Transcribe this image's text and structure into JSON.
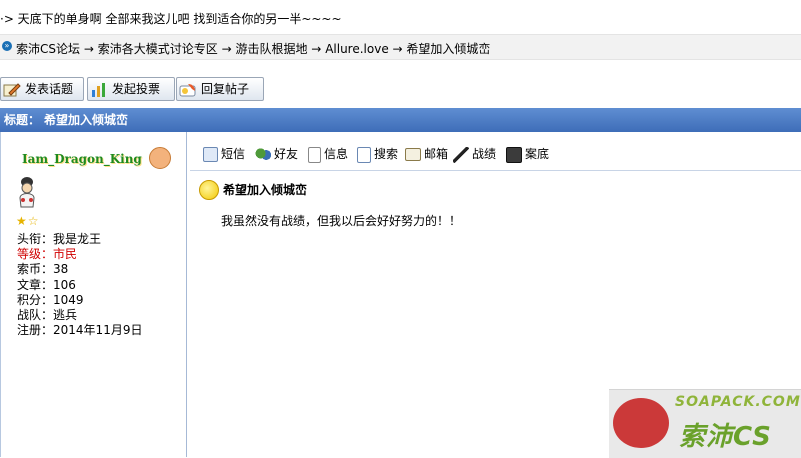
{
  "marquee": {
    "text": "·> 天底下的单身啊 全部来我这儿吧 找到适合你的另一半~~~~"
  },
  "breadcrumb": {
    "items": [
      "索沛CS论坛",
      "索沛各大模式讨论专区",
      "游击队根据地",
      "Allure.love",
      "希望加入倾城峦"
    ],
    "separator": "→"
  },
  "toolbar": {
    "new_topic": "发表话题",
    "new_poll": "发起投票",
    "reply": "回复帖子"
  },
  "topic": {
    "label": "标题：",
    "title": "希望加入倾城峦"
  },
  "user": {
    "name": "Iam_Dragon_King",
    "stars": "★☆",
    "title_label": "头衔：",
    "title_value": "我是龙王",
    "level_label": "等级：",
    "level_value": "市民",
    "coins_label": "索币：",
    "coins_value": "38",
    "posts_label": "文章：",
    "posts_value": "106",
    "points_label": "积分：",
    "points_value": "1049",
    "team_label": "战队：",
    "team_value": "逃兵",
    "reg_label": "注册：",
    "reg_value": "2014年11月9日"
  },
  "actions": {
    "sms": "短信",
    "friend": "好友",
    "info": "信息",
    "search": "搜索",
    "email": "邮箱",
    "record": "战绩",
    "case": "案底"
  },
  "post": {
    "title": "希望加入倾城峦",
    "body": "我虽然没有战绩，但我以后会好好努力的！！"
  },
  "watermark": {
    "top": "SOAPACK.COM",
    "brand": "索沛CS"
  },
  "colors": {
    "title_bar": "#4a7bc6",
    "username": "#1f8a1f",
    "level": "#d00000"
  }
}
